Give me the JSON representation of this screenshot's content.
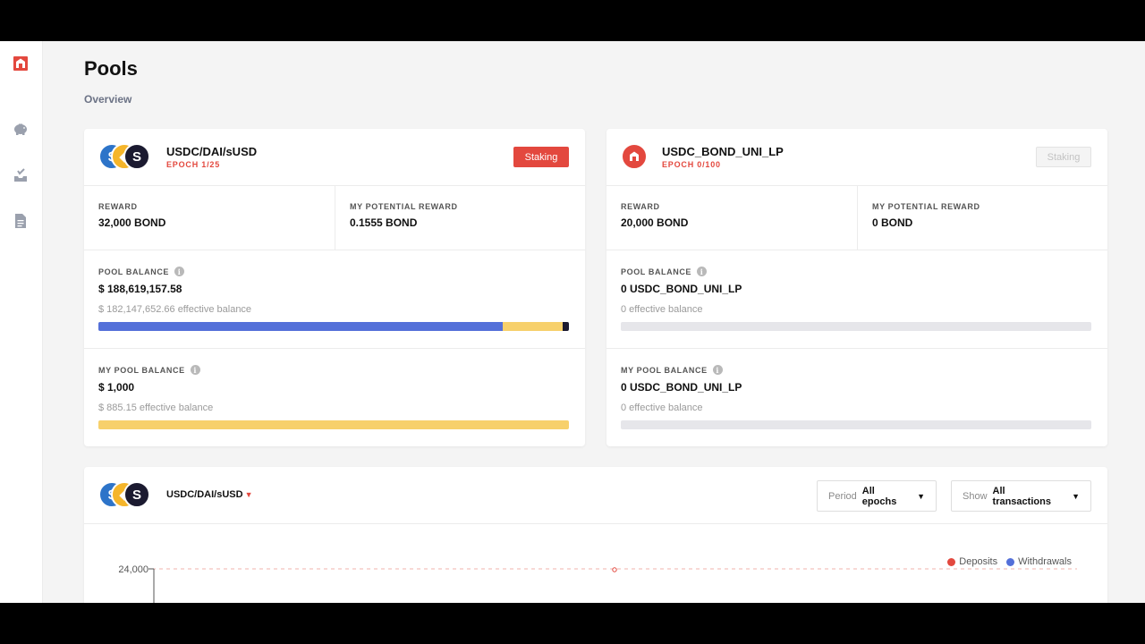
{
  "page": {
    "title": "Pools",
    "subtitle": "Overview"
  },
  "sidebar": {
    "items": [
      {
        "name": "logo",
        "icon": "bond-logo-icon"
      },
      {
        "name": "pools",
        "icon": "piggy-bank-icon"
      },
      {
        "name": "staking",
        "icon": "inbox-tray-icon"
      },
      {
        "name": "docs",
        "icon": "document-icon"
      }
    ]
  },
  "colors": {
    "accent": "#e3483e",
    "usdc": "#5470d9",
    "dai": "#f7d06b",
    "susd": "#1b1a30",
    "empty_bar": "#e6e6ea"
  },
  "pools": [
    {
      "name": "USDC/DAI/sUSD",
      "epoch": "EPOCH 1/25",
      "staking_label": "Staking",
      "staking_enabled": true,
      "reward_label": "REWARD",
      "reward_value": "32,000 BOND",
      "potential_label": "MY POTENTIAL REWARD",
      "potential_value": "0.1555 BOND",
      "pool_balance_label": "POOL BALANCE",
      "pool_balance_value": "$ 188,619,157.58",
      "pool_effective": "$ 182,147,652.66 effective balance",
      "pool_bar": [
        0.86,
        0.126,
        0.014
      ],
      "my_balance_label": "MY POOL BALANCE",
      "my_balance_value": "$ 1,000",
      "my_effective": "$ 885.15 effective balance",
      "my_bar": [
        0,
        1.0,
        0
      ]
    },
    {
      "name": "USDC_BOND_UNI_LP",
      "epoch": "EPOCH 0/100",
      "staking_label": "Staking",
      "staking_enabled": false,
      "reward_label": "REWARD",
      "reward_value": "20,000 BOND",
      "potential_label": "MY POTENTIAL REWARD",
      "potential_value": "0 BOND",
      "pool_balance_label": "POOL BALANCE",
      "pool_balance_value": "0 USDC_BOND_UNI_LP",
      "pool_effective": "0 effective balance",
      "pool_bar": [
        0,
        0,
        0
      ],
      "my_balance_label": "MY POOL BALANCE",
      "my_balance_value": "0 USDC_BOND_UNI_LP",
      "my_effective": "0 effective balance",
      "my_bar": [
        0,
        0,
        0
      ]
    }
  ],
  "transactions": {
    "pool": "USDC/DAI/sUSD",
    "period_label": "Period",
    "period_value": "All epochs",
    "show_label": "Show",
    "show_value": "All transactions"
  },
  "chart_data": {
    "type": "line",
    "y_ticks": [
      "24,000"
    ],
    "series": [
      {
        "name": "Deposits",
        "color": "#e3483e"
      },
      {
        "name": "Withdrawals",
        "color": "#5470d9"
      }
    ]
  }
}
